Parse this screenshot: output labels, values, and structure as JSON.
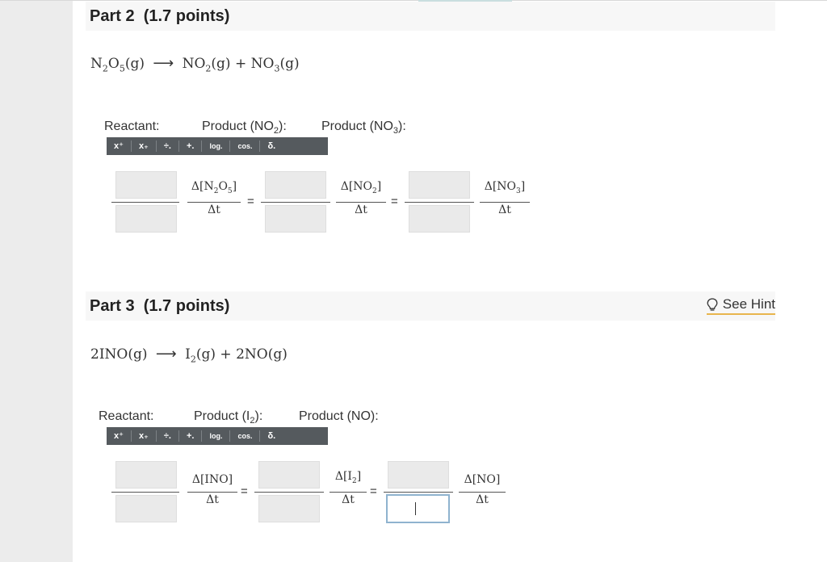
{
  "part2": {
    "title": "Part 2",
    "points": "(1.7 points)",
    "equation": {
      "reactant_parts": [
        "N",
        "2",
        "O",
        "5",
        "(g)"
      ],
      "arrow": "⟶",
      "product1_parts": [
        "NO",
        "2",
        "(g)"
      ],
      "plus": "+",
      "product2_parts": [
        "NO",
        "3",
        "(g)"
      ]
    },
    "labels": {
      "reactant": "Reactant:",
      "product1": [
        "Product (NO",
        "2",
        "):"
      ],
      "product2": [
        "Product (NO",
        "3",
        "):"
      ]
    },
    "rates": [
      {
        "num_parts": [
          "Δ[N",
          "2",
          "O",
          "5",
          "]"
        ],
        "den": "Δt"
      },
      {
        "num_parts": [
          "Δ[NO",
          "2",
          "]"
        ],
        "den": "Δt"
      },
      {
        "num_parts": [
          "Δ[NO",
          "3",
          "]"
        ],
        "den": "Δt"
      }
    ],
    "equals": "="
  },
  "part3": {
    "title": "Part 3",
    "points": "(1.7 points)",
    "hint_label": "See Hint",
    "hint_icon": "lightbulb-icon",
    "equation": {
      "reactant_parts": [
        "2INO",
        "(g)"
      ],
      "arrow": "⟶",
      "product1_parts": [
        "I",
        "2",
        "(g)"
      ],
      "plus": "+",
      "product2_parts": [
        "2NO",
        "(g)"
      ]
    },
    "labels": {
      "reactant": "Reactant:",
      "product1": [
        "Product (I",
        "2",
        "):"
      ],
      "product2": "Product (NO):"
    },
    "rates": [
      {
        "num": "Δ[INO]",
        "den": "Δt"
      },
      {
        "num_parts": [
          "Δ[I",
          "2",
          "]"
        ],
        "den": "Δt"
      },
      {
        "num": "Δ[NO]",
        "den": "Δt"
      }
    ],
    "equals": "="
  },
  "toolbar": {
    "buttons": [
      "x⁺",
      "x₊",
      "÷.",
      "+.",
      "log.",
      "cos.",
      "δ."
    ]
  }
}
